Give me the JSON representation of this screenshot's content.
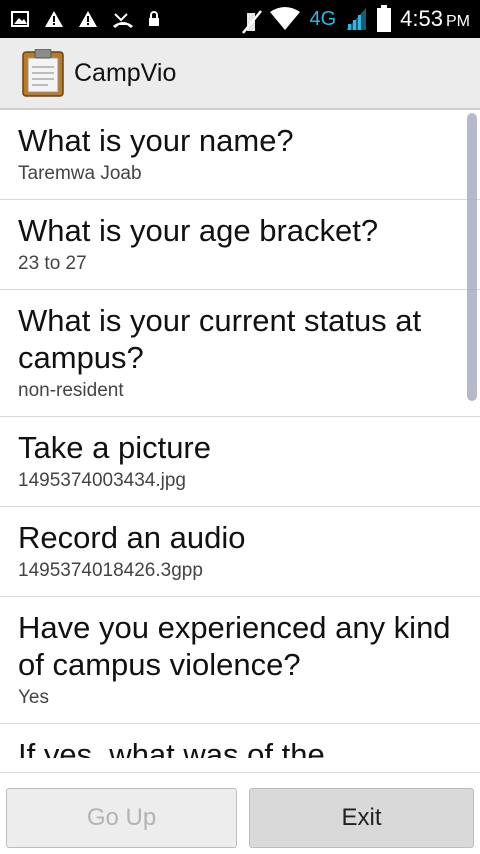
{
  "status_bar": {
    "time": "4:53",
    "ampm": "PM",
    "network": "4G",
    "icons": [
      "image-icon",
      "warning-icon",
      "warning-icon",
      "missed-call-icon",
      "lock-icon",
      "mute-icon",
      "wifi-icon",
      "signal-icon",
      "battery-icon"
    ]
  },
  "app": {
    "title": "CampVio",
    "icon": "clipboard-icon"
  },
  "questions": [
    {
      "question": "What is your name?",
      "answer": "Taremwa Joab"
    },
    {
      "question": "What is your age bracket?",
      "answer": "23 to 27"
    },
    {
      "question": "What is your current status at campus?",
      "answer": "non-resident"
    },
    {
      "question": "Take a picture",
      "answer": "1495374003434.jpg"
    },
    {
      "question": "Record an audio",
      "answer": "1495374018426.3gpp"
    },
    {
      "question": "Have you experienced any kind of campus violence?",
      "answer": "Yes"
    },
    {
      "question": "If yes, what was of the",
      "answer": ""
    }
  ],
  "buttons": {
    "go_up": "Go Up",
    "exit": "Exit"
  },
  "colors": {
    "status_bar_bg": "#000000",
    "action_bar_bg": "#ececec",
    "network_accent": "#33b5e5",
    "disabled_text": "#b3b3b3"
  }
}
